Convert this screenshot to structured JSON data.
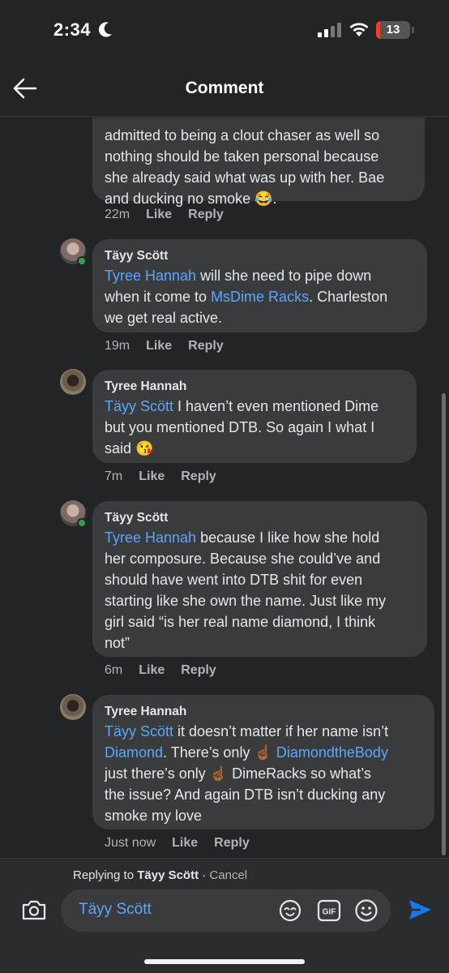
{
  "status_bar": {
    "time": "2:34",
    "battery": "13",
    "battery_level": 0.13
  },
  "header": {
    "title": "Comment"
  },
  "comments": [
    {
      "lines": [
        "admitted to being a clout chaser as well so",
        "nothing should be taken personal because",
        "she already said what was up with her. Bae",
        "and ducking no smoke 😂."
      ],
      "time": "22m",
      "like": "Like",
      "reply": "Reply"
    },
    {
      "author": "Täyy Scött",
      "mention1": "Tyree Hannah",
      "text1": " will she need to pipe down",
      "text2": "when it come to ",
      "mention2": "MsDime Racks",
      "text3": ". Charleston",
      "text4": "we get real active.",
      "time": "19m",
      "like": "Like",
      "reply": "Reply"
    },
    {
      "author": "Tyree Hannah",
      "mention1": "Täyy Scött",
      "text1": " I haven’t even mentioned Dime",
      "text2": "but you mentioned DTB. So again I what I",
      "text3": "said 😘",
      "time": "7m",
      "like": "Like",
      "reply": "Reply"
    },
    {
      "author": "Täyy Scött",
      "mention1": "Tyree Hannah",
      "text1": " because I like how she hold",
      "text2": "her composure. Because she could’ve and",
      "text3": "should have went into DTB shit for even",
      "text4": "starting like she own the name. Just like my",
      "text5": "girl said “is her real name diamond, I think",
      "text6": "not”",
      "time": "6m",
      "like": "Like",
      "reply": "Reply"
    },
    {
      "author": "Tyree Hannah",
      "mention1": "Täyy Scött",
      "text1": " it doesn’t matter if her name isn’t",
      "mention2": "Diamond",
      "text2": ". There’s only ☝🏾 ",
      "mention3": "DiamondtheBody",
      "text3": "just there’s only ☝🏾 DimeRacks so what’s",
      "text4": "the issue? And again DTB isn’t ducking any",
      "text5": "smoke my love",
      "time": "Just now",
      "like": "Like",
      "reply": "Reply"
    }
  ],
  "reply_bar": {
    "replying_prefix": "Replying to ",
    "replying_name": "Täyy Scött",
    "separator": " · ",
    "cancel": "Cancel",
    "input_value": "Täyy Scött"
  },
  "colors": {
    "background": "#232426",
    "bubble": "#3a3b3c",
    "mention": "#5aa7ff",
    "send": "#1877f2",
    "online": "#31a24c"
  }
}
